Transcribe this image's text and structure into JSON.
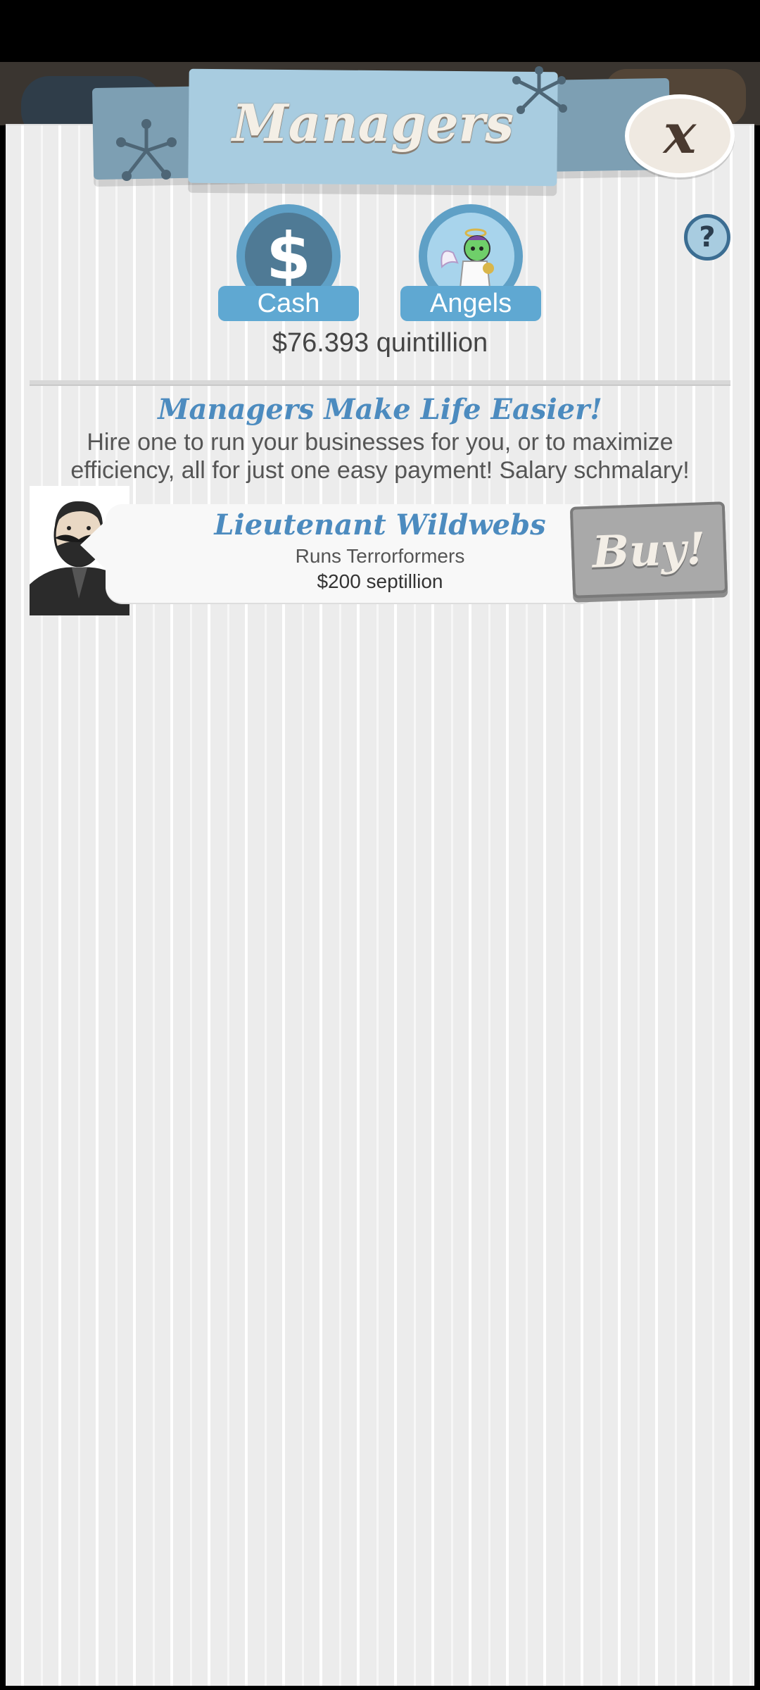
{
  "header": {
    "title": "Managers",
    "close_label": "x",
    "help_label": "?"
  },
  "tabs": [
    {
      "label": "Cash",
      "icon": "dollar-icon",
      "glyph": "$"
    },
    {
      "label": "Angels",
      "icon": "angel-icon"
    }
  ],
  "cash_amount": "$76.393 quintillion",
  "promo": {
    "title": "Managers Make Life Easier!",
    "text": "Hire one to run your businesses for you, or to maximize efficiency, all for just one easy payment! Salary schmalary!"
  },
  "managers": [
    {
      "name": "Lieutenant Wildwebs",
      "runs": "Runs Terrorformers",
      "price": "$200 septillion",
      "buy_label": "Buy!"
    }
  ],
  "colors": {
    "accent": "#4c8bbf",
    "tab_blue": "#5fa8d2",
    "banner": "#a8cce0",
    "buy_disabled": "#a9a9a9"
  }
}
